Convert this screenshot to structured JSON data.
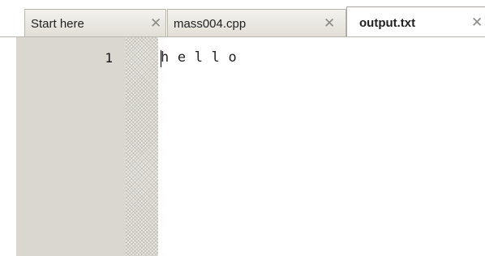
{
  "tabs": [
    {
      "label": "Start here",
      "close": "✕",
      "active": false
    },
    {
      "label": "mass004.cpp",
      "close": "✕",
      "active": false
    },
    {
      "label": "output.txt",
      "close": "✕",
      "active": true
    }
  ],
  "editor": {
    "line_numbers": [
      "1"
    ],
    "lines": [
      "h e l l o"
    ]
  },
  "colors": {
    "gutter": "#dad7d0",
    "tab_border": "#b9b6ad",
    "text": "#222222"
  },
  "icons": {
    "tab_close": "close-icon"
  }
}
